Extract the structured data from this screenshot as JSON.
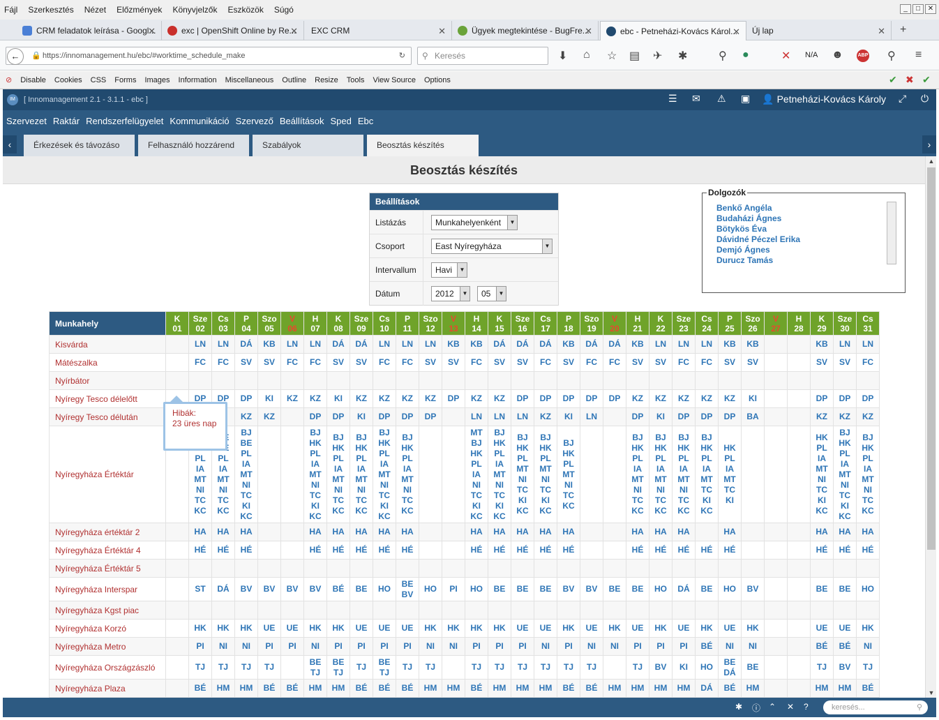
{
  "browser": {
    "menu": [
      "Fájl",
      "Szerkesztés",
      "Nézet",
      "Előzmények",
      "Könyvjelzők",
      "Eszközök",
      "Súgó"
    ],
    "tabs": [
      {
        "label": "CRM feladatok leírása - Googl...",
        "color": "#4a7fd6"
      },
      {
        "label": "exc | OpenShift Online by Re...",
        "color": "#c9302c"
      },
      {
        "label": "EXC CRM",
        "color": ""
      },
      {
        "label": "Ügyek megtekintése - BugFre...",
        "color": "#6aa33a"
      },
      {
        "label": "ebc - Petneházi-Kovács Károl...",
        "color": "#214a6f"
      },
      {
        "label": "Új lap",
        "color": ""
      }
    ],
    "url": "https://innomanagement.hu/ebc/#worktime_schedule_make",
    "search_placeholder": "Keresés",
    "na_label": "N/A",
    "dev_toolbar": [
      "Disable",
      "Cookies",
      "CSS",
      "Forms",
      "Images",
      "Information",
      "Miscellaneous",
      "Outline",
      "Resize",
      "Tools",
      "View Source",
      "Options"
    ]
  },
  "app": {
    "title": "[ Innomanagement 2.1 - 3.1.1 - ebc ]",
    "user": "Petneházi-Kovács Károly",
    "menu": [
      "Szervezet",
      "Raktár",
      "Rendszerfelügyelet",
      "Kommunikáció",
      "Szervező",
      "Beállítások",
      "Sped",
      "Ebc"
    ],
    "tabs": [
      "Érkezések és távozáso",
      "Felhasználó hozzárend",
      "Szabályok",
      "Beosztás készítés"
    ],
    "page_title": "Beosztás készítés",
    "footer_search_placeholder": "keresés..."
  },
  "settings": {
    "header": "Beállítások",
    "rows": [
      {
        "label": "Listázás",
        "value": "Munkahelyenként"
      },
      {
        "label": "Csoport",
        "value": "East Nyíregyháza"
      },
      {
        "label": "Intervallum",
        "value": "Havi"
      },
      {
        "label": "Dátum",
        "value": "2012",
        "value2": "05"
      }
    ]
  },
  "workers": {
    "legend": "Dolgozók",
    "names": [
      "Benkő Angéla",
      "Budaházi Ágnes",
      "Bötykös Éva",
      "Dávidné Péczel Erika",
      "Demjó Ágnes",
      "Durucz Tamás"
    ]
  },
  "tooltip": {
    "line1": "Hibák:",
    "line2": "23 üres nap"
  },
  "schedule": {
    "col_header": "Munkahely",
    "days": [
      {
        "d": "K",
        "n": "01",
        "wk": false
      },
      {
        "d": "Sze",
        "n": "02",
        "wk": false
      },
      {
        "d": "Cs",
        "n": "03",
        "wk": false
      },
      {
        "d": "P",
        "n": "04",
        "wk": false
      },
      {
        "d": "Szo",
        "n": "05",
        "wk": false
      },
      {
        "d": "V",
        "n": "06",
        "wk": true
      },
      {
        "d": "H",
        "n": "07",
        "wk": false
      },
      {
        "d": "K",
        "n": "08",
        "wk": false
      },
      {
        "d": "Sze",
        "n": "09",
        "wk": false
      },
      {
        "d": "Cs",
        "n": "10",
        "wk": false
      },
      {
        "d": "P",
        "n": "11",
        "wk": false
      },
      {
        "d": "Szo",
        "n": "12",
        "wk": false
      },
      {
        "d": "V",
        "n": "13",
        "wk": true
      },
      {
        "d": "H",
        "n": "14",
        "wk": false
      },
      {
        "d": "K",
        "n": "15",
        "wk": false
      },
      {
        "d": "Sze",
        "n": "16",
        "wk": false
      },
      {
        "d": "Cs",
        "n": "17",
        "wk": false
      },
      {
        "d": "P",
        "n": "18",
        "wk": false
      },
      {
        "d": "Szo",
        "n": "19",
        "wk": false
      },
      {
        "d": "V",
        "n": "20",
        "wk": true
      },
      {
        "d": "H",
        "n": "21",
        "wk": false
      },
      {
        "d": "K",
        "n": "22",
        "wk": false
      },
      {
        "d": "Sze",
        "n": "23",
        "wk": false
      },
      {
        "d": "Cs",
        "n": "24",
        "wk": false
      },
      {
        "d": "P",
        "n": "25",
        "wk": false
      },
      {
        "d": "Szo",
        "n": "26",
        "wk": false
      },
      {
        "d": "V",
        "n": "27",
        "wk": true
      },
      {
        "d": "H",
        "n": "28",
        "wk": false
      },
      {
        "d": "K",
        "n": "29",
        "wk": false
      },
      {
        "d": "Sze",
        "n": "30",
        "wk": false
      },
      {
        "d": "Cs",
        "n": "31",
        "wk": false
      }
    ],
    "rows": [
      {
        "name": "Kisvárda",
        "cells": [
          "",
          "LN",
          "LN",
          "DÁ",
          "KB",
          "LN",
          "LN",
          "DÁ",
          "DÁ",
          "LN",
          "LN",
          "LN",
          "KB",
          "KB",
          "DÁ",
          "DÁ",
          "DÁ",
          "KB",
          "DÁ",
          "DÁ",
          "KB",
          "LN",
          "LN",
          "LN",
          "KB",
          "KB",
          "",
          "",
          "KB",
          "LN",
          "LN"
        ]
      },
      {
        "name": "Mátészalka",
        "cells": [
          "",
          "FC",
          "FC",
          "SV",
          "SV",
          "FC",
          "FC",
          "SV",
          "SV",
          "FC",
          "FC",
          "SV",
          "SV",
          "FC",
          "SV",
          "SV",
          "FC",
          "SV",
          "FC",
          "FC",
          "SV",
          "SV",
          "FC",
          "FC",
          "SV",
          "SV",
          "",
          "",
          "SV",
          "SV",
          "FC"
        ]
      },
      {
        "name": "Nyírbátor",
        "cells": [
          "",
          "",
          "",
          "",
          "",
          "",
          "",
          "",
          "",
          "",
          "",
          "",
          "",
          "",
          "",
          "",
          "",
          "",
          "",
          "",
          "",
          "",
          "",
          "",
          "",
          "",
          "",
          "",
          "",
          "",
          ""
        ]
      },
      {
        "name": "Nyíregy Tesco délelőtt",
        "cells": [
          "",
          "DP",
          "DP",
          "DP",
          "KI",
          "KZ",
          "KZ",
          "KI",
          "KZ",
          "KZ",
          "KZ",
          "KZ",
          "DP",
          "KZ",
          "KZ",
          "DP",
          "DP",
          "DP",
          "DP",
          "DP",
          "KZ",
          "KZ",
          "KZ",
          "KZ",
          "KZ",
          "KI",
          "",
          "",
          "DP",
          "DP",
          "DP"
        ]
      },
      {
        "name": "Nyíregy Tesco délután",
        "cells": [
          "",
          "",
          "",
          "KZ",
          "KZ",
          "",
          "DP",
          "DP",
          "KI",
          "DP",
          "DP",
          "DP",
          "",
          "LN",
          "LN",
          "LN",
          "KZ",
          "KI",
          "LN",
          "",
          "DP",
          "KI",
          "DP",
          "DP",
          "DP",
          "BA",
          "",
          "",
          "KZ",
          "KZ",
          "KZ"
        ]
      },
      {
        "name": "Nyíregyháza Értéktár",
        "cells": [
          "",
          "BJ BE PL IA MT NI TC KC",
          "BE BE PL IA MT NI TC KC",
          "BJ BE PL IA MT NI TC KI KC",
          "",
          "",
          "BJ HK PL IA MT NI TC KI KC",
          "BJ HK PL IA MT NI TC KC",
          "BJ HK PL IA MT NI TC KC",
          "BJ HK PL IA MT NI TC KI KC",
          "BJ HK PL IA MT NI TC KC",
          "",
          "",
          "MT BJ HK PL IA NI TC KI KC",
          "BJ HK PL IA MT NI TC KI KC",
          "BJ HK PL MT NI TC KI KC",
          "BJ HK PL MT NI TC KI KC",
          "BJ HK PL MT NI TC KC",
          "",
          "",
          "BJ HK PL IA MT NI TC KC",
          "BJ HK PL IA MT NI TC KC",
          "BJ HK PL IA MT NI TC KC",
          "BJ HK PL IA MT TC KI KC",
          "HK PL IA MT TC KI",
          "",
          "",
          "",
          "HK PL IA MT NI TC KI KC",
          "BJ HK PL IA MT NI TC KI KC",
          "BJ HK PL IA MT NI TC KC"
        ]
      },
      {
        "name": "Nyíregyháza értéktár 2",
        "cells": [
          "",
          "HA",
          "HA",
          "HA",
          "",
          "",
          "HA",
          "HA",
          "HA",
          "HA",
          "HA",
          "",
          "",
          "HA",
          "HA",
          "HA",
          "HA",
          "HA",
          "",
          "",
          "HA",
          "HA",
          "HA",
          "",
          "HA",
          "",
          "",
          "",
          "HA",
          "HA",
          "HA"
        ]
      },
      {
        "name": "Nyíregyháza Értéktár 4",
        "cells": [
          "",
          "HÉ",
          "HÉ",
          "HÉ",
          "",
          "",
          "HÉ",
          "HÉ",
          "HÉ",
          "HÉ",
          "HÉ",
          "",
          "",
          "HÉ",
          "HÉ",
          "HÉ",
          "HÉ",
          "HÉ",
          "",
          "",
          "HÉ",
          "HÉ",
          "HÉ",
          "HÉ",
          "HÉ",
          "",
          "",
          "",
          "HÉ",
          "HÉ",
          "HÉ"
        ]
      },
      {
        "name": "Nyíregyháza Értéktár 5",
        "cells": [
          "",
          "",
          "",
          "",
          "",
          "",
          "",
          "",
          "",
          "",
          "",
          "",
          "",
          "",
          "",
          "",
          "",
          "",
          "",
          "",
          "",
          "",
          "",
          "",
          "",
          "",
          "",
          "",
          "",
          "",
          ""
        ]
      },
      {
        "name": "Nyíregyháza Interspar",
        "cells": [
          "",
          "ST",
          "DÁ",
          "BV",
          "BV",
          "BV",
          "BV",
          "BÉ",
          "BE",
          "HO",
          "BE BV",
          "HO",
          "PI",
          "HO",
          "BE",
          "BE",
          "BE",
          "BV",
          "BV",
          "BE",
          "BE",
          "HO",
          "DÁ",
          "BE",
          "HO",
          "BV",
          "",
          "",
          "BE",
          "BE",
          "HO"
        ]
      },
      {
        "name": "Nyíregyháza Kgst piac",
        "cells": [
          "",
          "",
          "",
          "",
          "",
          "",
          "",
          "",
          "",
          "",
          "",
          "",
          "",
          "",
          "",
          "",
          "",
          "",
          "",
          "",
          "",
          "",
          "",
          "",
          "",
          "",
          "",
          "",
          "",
          "",
          ""
        ]
      },
      {
        "name": "Nyíregyháza Korzó",
        "cells": [
          "",
          "HK",
          "HK",
          "HK",
          "UE",
          "UE",
          "HK",
          "HK",
          "UE",
          "UE",
          "UE",
          "HK",
          "HK",
          "HK",
          "HK",
          "UE",
          "UE",
          "HK",
          "UE",
          "HK",
          "UE",
          "HK",
          "UE",
          "HK",
          "UE",
          "HK",
          "",
          "",
          "UE",
          "UE",
          "HK"
        ]
      },
      {
        "name": "Nyíregyháza Metro",
        "cells": [
          "",
          "PI",
          "NI",
          "NI",
          "PI",
          "PI",
          "NI",
          "PI",
          "PI",
          "PI",
          "PI",
          "NI",
          "NI",
          "PI",
          "PI",
          "PI",
          "NI",
          "PI",
          "NI",
          "NI",
          "PI",
          "PI",
          "PI",
          "BÉ",
          "NI",
          "NI",
          "",
          "",
          "BÉ",
          "BÉ",
          "NI"
        ]
      },
      {
        "name": "Nyíregyháza Országzászló",
        "cells": [
          "",
          "TJ",
          "TJ",
          "TJ",
          "TJ",
          "",
          "BE TJ",
          "BE TJ",
          "TJ",
          "BE TJ",
          "TJ",
          "TJ",
          "",
          "TJ",
          "TJ",
          "TJ",
          "TJ",
          "TJ",
          "TJ",
          "",
          "TJ",
          "BV",
          "KI",
          "HO",
          "BE DÁ",
          "BE",
          "",
          "",
          "TJ",
          "BV",
          "TJ"
        ]
      },
      {
        "name": "Nyíregyháza Plaza",
        "cells": [
          "",
          "BÉ",
          "HM",
          "HM",
          "BÉ",
          "BÉ",
          "HM",
          "HM",
          "BÉ",
          "BÉ",
          "BÉ",
          "HM",
          "HM",
          "BÉ",
          "HM",
          "HM",
          "HM",
          "BÉ",
          "BÉ",
          "HM",
          "HM",
          "HM",
          "HM",
          "DÁ",
          "BÉ",
          "HM",
          "",
          "",
          "HM",
          "HM",
          "BÉ"
        ]
      }
    ]
  }
}
